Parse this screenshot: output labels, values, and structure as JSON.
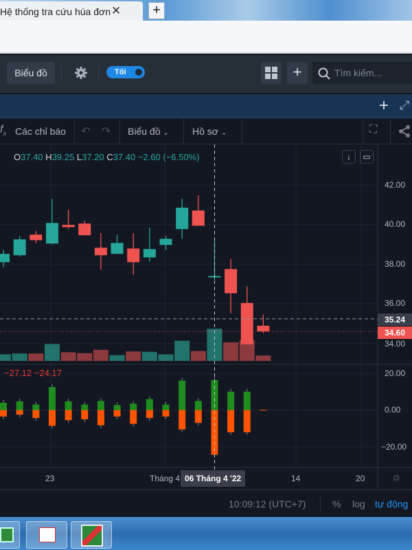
{
  "browser": {
    "tab_title": "Hệ thống tra cứu húa đơn",
    "close_glyph": "✕",
    "new_tab_glyph": "+"
  },
  "header": {
    "chart_button": "Biểu đồ",
    "theme_toggle": "Tối",
    "search_placeholder": "Tìm kiếm...",
    "add_glyph": "+"
  },
  "toolbar": {
    "indicators": "Các chỉ báo",
    "chart_menu": "Biểu đồ",
    "profile_menu": "Hồ sơ"
  },
  "legend": {
    "o_label": "O",
    "o": "37.40",
    "h_label": "H",
    "h": "39.25",
    "l_label": "L",
    "l": "37.20",
    "c_label": "C",
    "c": "37.40",
    "change": "−2.60 (−6.50%)"
  },
  "oscillator_legend": {
    "v1": "−27.12",
    "v2": "−24.17"
  },
  "price_axis": {
    "ticks": [
      "42.00",
      "40.00",
      "38.00",
      "36.00",
      "34.00"
    ],
    "crosshair_price": "35.24",
    "last_price": "34.60"
  },
  "osc_axis": {
    "ticks": [
      "20.00",
      "0.00",
      "−20.00"
    ]
  },
  "time_axis": {
    "ticks": [
      "23",
      "Tháng 4",
      "14",
      "20"
    ],
    "crosshair_date": "06 Tháng 4 '22"
  },
  "footer": {
    "clock": "10:09:12 (UTC+7)",
    "percent": "%",
    "log": "log",
    "auto": "tự động"
  },
  "colors": {
    "up": "#26a69a",
    "down": "#ef5350",
    "osc_up": "#1e8c1e",
    "osc_down": "#ff5500",
    "link": "#2196f3"
  },
  "chart_data": {
    "type": "candlestick",
    "price_range": [
      33.2,
      42.5
    ],
    "last_price": 34.6,
    "crosshair_price": 35.24,
    "candles": [
      {
        "o": 38.1,
        "h": 38.72,
        "l": 37.85,
        "c": 38.52
      },
      {
        "o": 38.45,
        "h": 39.42,
        "l": 38.38,
        "c": 39.25
      },
      {
        "o": 39.49,
        "h": 39.67,
        "l": 39.07,
        "c": 39.21
      },
      {
        "o": 39.04,
        "h": 41.3,
        "l": 39.0,
        "c": 40.08
      },
      {
        "o": 39.98,
        "h": 40.75,
        "l": 39.77,
        "c": 39.87
      },
      {
        "o": 40.05,
        "h": 40.19,
        "l": 39.46,
        "c": 39.46
      },
      {
        "o": 38.83,
        "h": 39.56,
        "l": 37.71,
        "c": 38.45
      },
      {
        "o": 38.52,
        "h": 39.49,
        "l": 38.52,
        "c": 39.07
      },
      {
        "o": 38.79,
        "h": 39.56,
        "l": 37.47,
        "c": 38.1
      },
      {
        "o": 38.34,
        "h": 39.84,
        "l": 38.13,
        "c": 38.76
      },
      {
        "o": 38.97,
        "h": 39.42,
        "l": 38.72,
        "c": 39.28
      },
      {
        "o": 39.77,
        "h": 41.3,
        "l": 39.28,
        "c": 40.85
      },
      {
        "o": 40.71,
        "h": 41.48,
        "l": 39.94,
        "c": 39.94
      },
      {
        "o": 37.4,
        "h": 39.25,
        "l": 37.2,
        "c": 37.4
      },
      {
        "o": 37.75,
        "h": 38.27,
        "l": 35.52,
        "c": 36.53
      },
      {
        "o": 36.04,
        "h": 36.88,
        "l": 33.95,
        "c": 33.95
      },
      {
        "o": 34.89,
        "h": 35.45,
        "l": 34.51,
        "c": 34.6
      }
    ],
    "volume_relative": [
      16,
      18,
      18,
      41,
      21,
      19,
      27,
      14,
      23,
      22,
      16,
      49,
      24,
      78,
      45,
      50,
      13
    ],
    "volume_up": [
      true,
      true,
      false,
      true,
      false,
      false,
      false,
      true,
      false,
      true,
      true,
      true,
      false,
      true,
      false,
      false,
      false
    ],
    "oscillator": {
      "range": [
        -30,
        24
      ],
      "positive": [
        4.0,
        4.8,
        3.0,
        12.6,
        4.8,
        3.0,
        5.0,
        2.8,
        3.5,
        6.0,
        3.0,
        16.1,
        5.0,
        16.4,
        10.1,
        10.1,
        0
      ],
      "negative": [
        -3.5,
        -2.5,
        -4.3,
        -8.6,
        -5.5,
        -5.0,
        -8.3,
        -3.5,
        -7.5,
        -4.3,
        -3.5,
        -10.6,
        -7.0,
        -24.4,
        -12.1,
        -12.1,
        0
      ]
    }
  }
}
